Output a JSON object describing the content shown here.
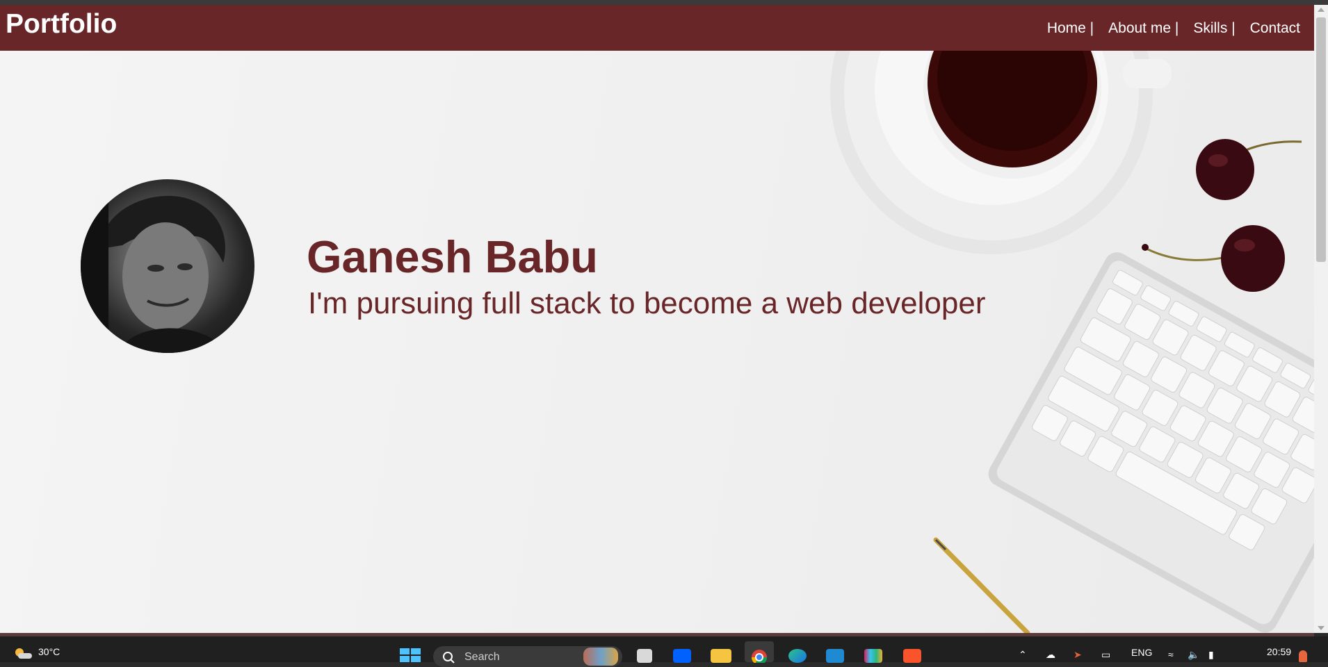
{
  "navbar": {
    "brand": "Portfolio",
    "links": [
      {
        "label": "Home |"
      },
      {
        "label": "About me |"
      },
      {
        "label": "Skills |"
      },
      {
        "label": "Contact"
      }
    ]
  },
  "hero": {
    "name": "Ganesh Babu",
    "tagline": "I'm pursuing full stack to become a web developer"
  },
  "colors": {
    "brand": "#692628",
    "page_background": "#f0f0f0",
    "taskbar": "#202020"
  },
  "taskbar": {
    "weather": {
      "temperature": "30°C",
      "icon": "weather-sun-cloud-icon"
    },
    "search_placeholder": "Search",
    "pinned_apps": [
      "start-icon",
      "file-icon",
      "dropbox-icon",
      "file-explorer-icon",
      "chrome-icon",
      "edge-icon",
      "vscode-icon",
      "slack-icon",
      "brave-icon"
    ],
    "tray": {
      "language": "ENG",
      "time": "20:59"
    }
  }
}
